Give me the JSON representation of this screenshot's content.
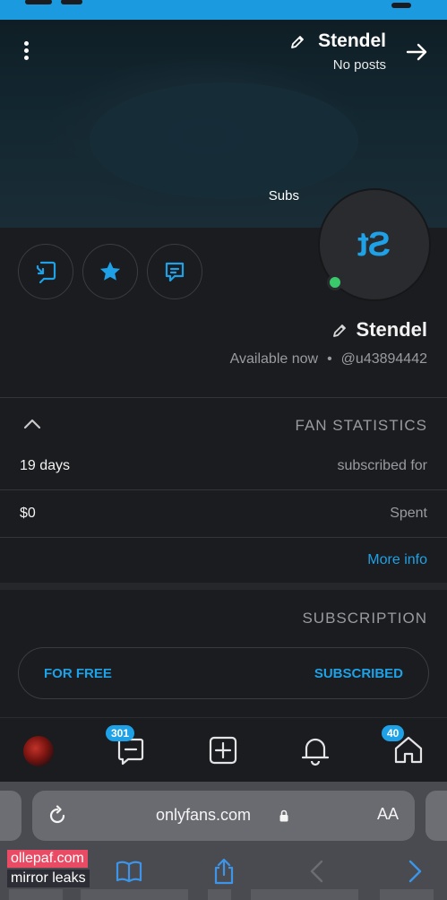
{
  "colors": {
    "accent": "#1ea1e6",
    "online": "#39c96a",
    "background": "#1b1c1f",
    "status_bar": "#1b9ae0"
  },
  "header": {
    "name": "Stendel",
    "posts": "No posts",
    "subs_label": "Subs"
  },
  "profile": {
    "initials": "St",
    "name": "Stendel",
    "handle": "@u43894442",
    "separator": "•",
    "status": "Available now"
  },
  "actions": [
    "chat-icon",
    "star-icon",
    "tip-icon"
  ],
  "fan_statistics": {
    "title": "FAN STATISTICS",
    "rows": [
      {
        "label": "subscribed for",
        "value": "19 days"
      },
      {
        "label": "Spent",
        "value": "$0"
      }
    ],
    "more_info": "More info"
  },
  "subscription": {
    "title": "SUBSCRIPTION",
    "status": "SUBSCRIBED",
    "price": "FOR FREE"
  },
  "bottom_nav": {
    "messages_badge": "301",
    "home_badge": "40"
  },
  "browser": {
    "url": "onlyfans.com",
    "text_size": "AA"
  },
  "watermark": {
    "line1": "ollepaf.com",
    "line2": "mirror leaks"
  }
}
